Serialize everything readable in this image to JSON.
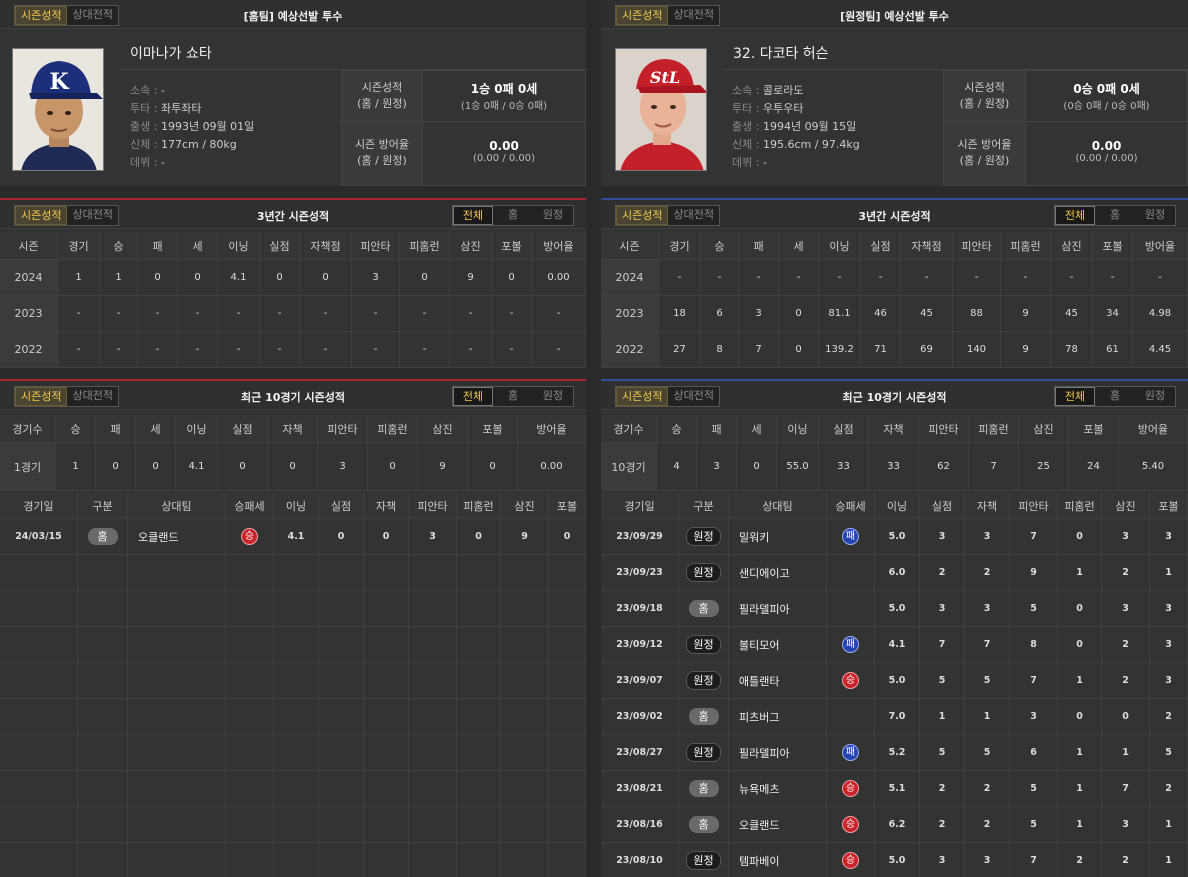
{
  "tabs": {
    "season": "시즌성적",
    "vs": "상대전적"
  },
  "filters": [
    "전체",
    "홈",
    "원정"
  ],
  "left": {
    "header_title": "[홈팀] 예상선발 투수",
    "name": "이마나가 쇼타",
    "info": [
      {
        "label": "소속 :",
        "value": "-"
      },
      {
        "label": "투타 :",
        "value": "좌투좌타"
      },
      {
        "label": "출생 :",
        "value": "1993년 09월 01일"
      },
      {
        "label": "신체 :",
        "value": "177cm / 80kg"
      },
      {
        "label": "데뷔 :",
        "value": "-"
      }
    ],
    "record": {
      "label1": "시즌성적",
      "label2": "(홈 / 원정)",
      "value": "1승 0패 0세",
      "sub": "(1승 0패 / 0승 0패)"
    },
    "era": {
      "label1": "시즌 방어율",
      "label2": "(홈 / 원정)",
      "value": "0.00",
      "sub": "(0.00 / 0.00)"
    },
    "season3_title": "3년간 시즌성적",
    "season3_headers": [
      "시즌",
      "경기",
      "승",
      "패",
      "세",
      "이닝",
      "실점",
      "자책점",
      "피안타",
      "피홈런",
      "삼진",
      "포볼",
      "방어율"
    ],
    "season3_rows": [
      [
        "2024",
        "1",
        "1",
        "0",
        "0",
        "4.1",
        "0",
        "0",
        "3",
        "0",
        "9",
        "0",
        "0.00"
      ],
      [
        "2023",
        "-",
        "-",
        "-",
        "-",
        "-",
        "-",
        "-",
        "-",
        "-",
        "-",
        "-",
        "-"
      ],
      [
        "2022",
        "-",
        "-",
        "-",
        "-",
        "-",
        "-",
        "-",
        "-",
        "-",
        "-",
        "-",
        "-"
      ]
    ],
    "recent_title": "최근 10경기 시즌성적",
    "recent_headers": [
      "경기수",
      "승",
      "패",
      "세",
      "이닝",
      "실점",
      "자책",
      "피안타",
      "피홈런",
      "삼진",
      "포볼",
      "방어율"
    ],
    "recent_row": [
      "1경기",
      "1",
      "0",
      "0",
      "4.1",
      "0",
      "0",
      "3",
      "0",
      "9",
      "0",
      "0.00"
    ],
    "game_headers": [
      "경기일",
      "구분",
      "상대팀",
      "승패세",
      "이닝",
      "실점",
      "자책",
      "피안타",
      "피홈런",
      "삼진",
      "포볼"
    ],
    "games": [
      [
        "24/03/15",
        "홈",
        "오클랜드",
        "승",
        "4.1",
        "0",
        "0",
        "3",
        "0",
        "9",
        "0"
      ]
    ]
  },
  "right": {
    "header_title": "[원정팀] 예상선발 투수",
    "name": "32. 다코타 허슨",
    "info": [
      {
        "label": "소속 :",
        "value": "콜로라도"
      },
      {
        "label": "투타 :",
        "value": "우투우타"
      },
      {
        "label": "출생 :",
        "value": "1994년 09월 15일"
      },
      {
        "label": "신체 :",
        "value": "195.6cm / 97.4kg"
      },
      {
        "label": "데뷔 :",
        "value": "-"
      }
    ],
    "record": {
      "label1": "시즌성적",
      "label2": "(홈 / 원정)",
      "value": "0승 0패 0세",
      "sub": "(0승 0패 / 0승 0패)"
    },
    "era": {
      "label1": "시즌 방어율",
      "label2": "(홈 / 원정)",
      "value": "0.00",
      "sub": "(0.00 / 0.00)"
    },
    "season3_title": "3년간 시즌성적",
    "season3_headers": [
      "시즌",
      "경기",
      "승",
      "패",
      "세",
      "이닝",
      "실점",
      "자책점",
      "피안타",
      "피홈런",
      "삼진",
      "포볼",
      "방어율"
    ],
    "season3_rows": [
      [
        "2024",
        "-",
        "-",
        "-",
        "-",
        "-",
        "-",
        "-",
        "-",
        "-",
        "-",
        "-",
        "-"
      ],
      [
        "2023",
        "18",
        "6",
        "3",
        "0",
        "81.1",
        "46",
        "45",
        "88",
        "9",
        "45",
        "34",
        "4.98"
      ],
      [
        "2022",
        "27",
        "8",
        "7",
        "0",
        "139.2",
        "71",
        "69",
        "140",
        "9",
        "78",
        "61",
        "4.45"
      ]
    ],
    "recent_title": "최근 10경기 시즌성적",
    "recent_headers": [
      "경기수",
      "승",
      "패",
      "세",
      "이닝",
      "실점",
      "자책",
      "피안타",
      "피홈런",
      "삼진",
      "포볼",
      "방어율"
    ],
    "recent_row": [
      "10경기",
      "4",
      "3",
      "0",
      "55.0",
      "33",
      "33",
      "62",
      "7",
      "25",
      "24",
      "5.40"
    ],
    "game_headers": [
      "경기일",
      "구분",
      "상대팀",
      "승패세",
      "이닝",
      "실점",
      "자책",
      "피안타",
      "피홈런",
      "삼진",
      "포볼"
    ],
    "games": [
      [
        "23/09/29",
        "원정",
        "밀워키",
        "패",
        "5.0",
        "3",
        "3",
        "7",
        "0",
        "3",
        "3"
      ],
      [
        "23/09/23",
        "원정",
        "샌디에이고",
        "",
        "6.0",
        "2",
        "2",
        "9",
        "1",
        "2",
        "1"
      ],
      [
        "23/09/18",
        "홈",
        "필라델피아",
        "",
        "5.0",
        "3",
        "3",
        "5",
        "0",
        "3",
        "3"
      ],
      [
        "23/09/12",
        "원정",
        "볼티모어",
        "패",
        "4.1",
        "7",
        "7",
        "8",
        "0",
        "2",
        "3"
      ],
      [
        "23/09/07",
        "원정",
        "애틀랜타",
        "승",
        "5.0",
        "5",
        "5",
        "7",
        "1",
        "2",
        "3"
      ],
      [
        "23/09/02",
        "홈",
        "피츠버그",
        "",
        "7.0",
        "1",
        "1",
        "3",
        "0",
        "0",
        "2"
      ],
      [
        "23/08/27",
        "원정",
        "필라델피아",
        "패",
        "5.2",
        "5",
        "5",
        "6",
        "1",
        "1",
        "5"
      ],
      [
        "23/08/21",
        "홈",
        "뉴욕메츠",
        "승",
        "5.1",
        "2",
        "2",
        "5",
        "1",
        "7",
        "2"
      ],
      [
        "23/08/16",
        "홈",
        "오클랜드",
        "승",
        "6.2",
        "2",
        "2",
        "5",
        "1",
        "3",
        "1"
      ],
      [
        "23/08/10",
        "원정",
        "템파베이",
        "승",
        "5.0",
        "3",
        "3",
        "7",
        "2",
        "2",
        "1"
      ]
    ]
  },
  "colors": {
    "win": "#c9242a",
    "loss": "#2343b0",
    "accent": "#f2c84b",
    "home_line": "#a8262c",
    "away_line": "#304d9a"
  }
}
